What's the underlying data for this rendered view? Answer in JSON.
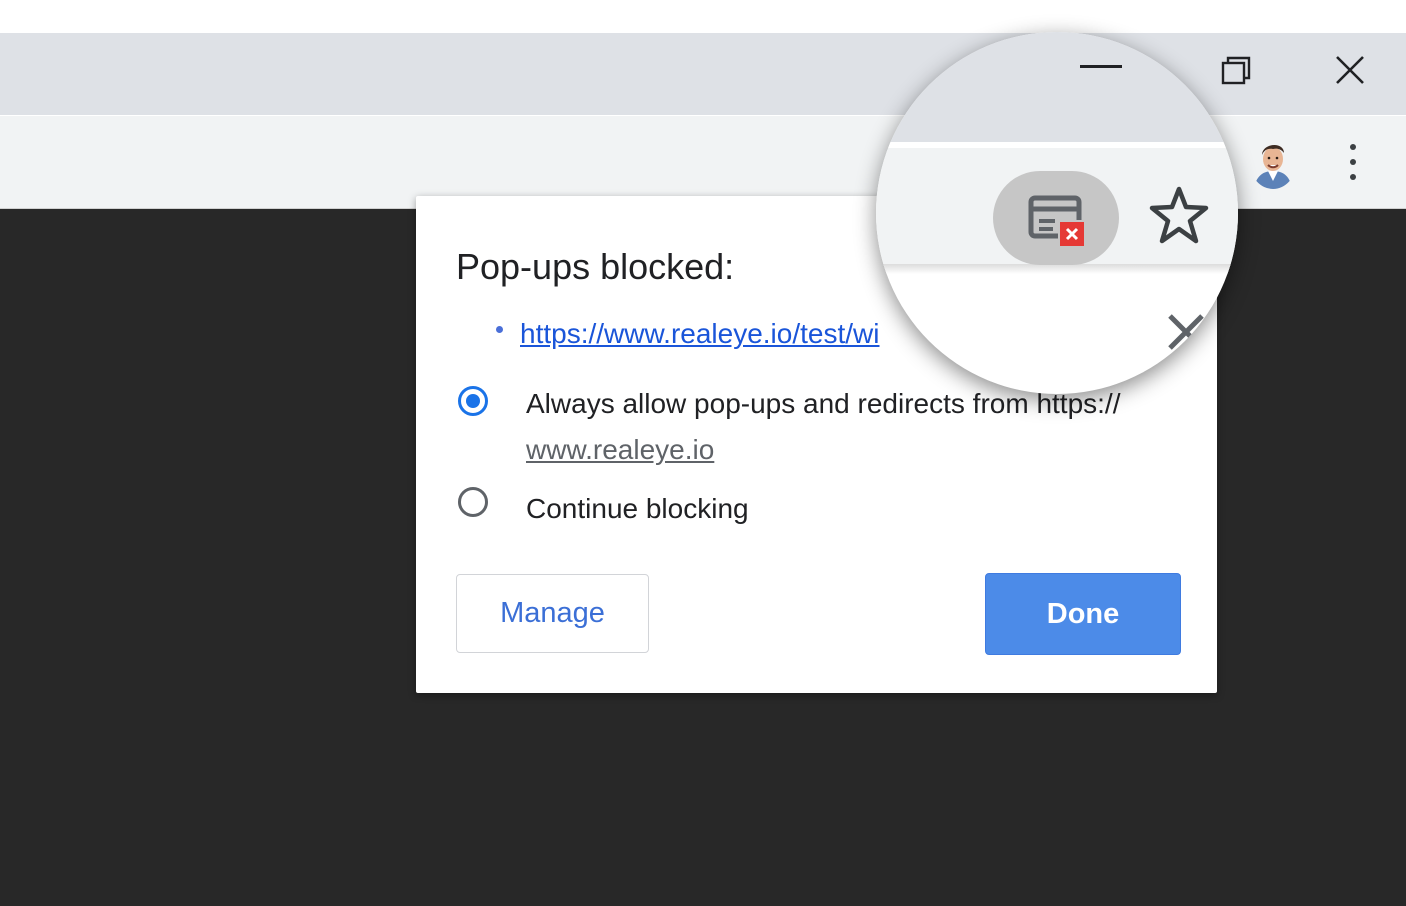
{
  "dialog": {
    "title": "Pop-ups blocked:",
    "blocked_link": "https://www.realeye.io/test/wi",
    "options": [
      {
        "label_prefix": "Always allow pop-ups and redirects from https://",
        "label_link": "www.realeye.io",
        "checked": true
      },
      {
        "label": "Continue blocking",
        "checked": false
      }
    ],
    "manage_label": "Manage",
    "done_label": "Done"
  },
  "icons": {
    "window_minimize": "minimize-icon",
    "window_restore": "restore-icon",
    "window_close": "close-icon",
    "profile": "avatar",
    "menu": "more-vert-icon",
    "popup_blocked": "popup-blocked-icon",
    "bookmark": "star-icon",
    "dialog_close": "close-icon"
  },
  "colors": {
    "accent": "#1a73e8",
    "done_button": "#4c8be8",
    "link": "#1a55d9",
    "blocked_badge": "#e53935"
  }
}
